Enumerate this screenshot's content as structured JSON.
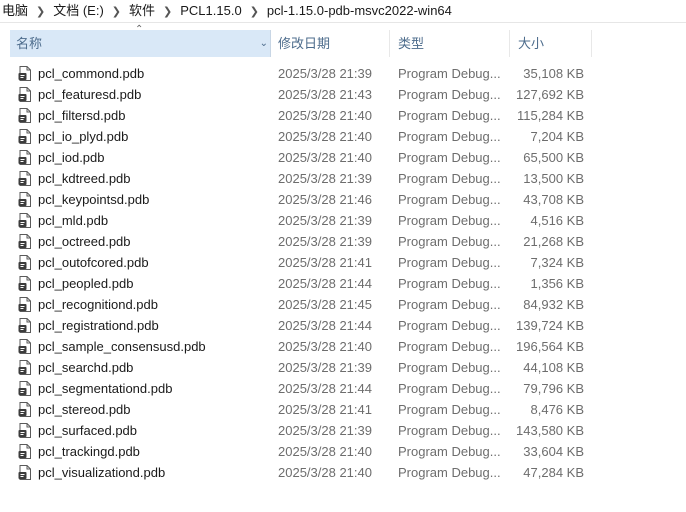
{
  "breadcrumb": [
    {
      "label": "电脑"
    },
    {
      "label": "文档 (E:)"
    },
    {
      "label": "软件"
    },
    {
      "label": "PCL1.15.0"
    },
    {
      "label": "pcl-1.15.0-pdb-msvc2022-win64"
    }
  ],
  "columns": {
    "name": "名称",
    "date": "修改日期",
    "type": "类型",
    "size": "大小"
  },
  "icons": {
    "file": "pdb-file-icon",
    "sort": "sort-up-icon",
    "dropdown": "chevron-down-icon"
  },
  "files": [
    {
      "name": "pcl_commond.pdb",
      "date": "2025/3/28 21:39",
      "type": "Program Debug...",
      "size": "35,108 KB"
    },
    {
      "name": "pcl_featuresd.pdb",
      "date": "2025/3/28 21:43",
      "type": "Program Debug...",
      "size": "127,692 KB"
    },
    {
      "name": "pcl_filtersd.pdb",
      "date": "2025/3/28 21:40",
      "type": "Program Debug...",
      "size": "115,284 KB"
    },
    {
      "name": "pcl_io_plyd.pdb",
      "date": "2025/3/28 21:40",
      "type": "Program Debug...",
      "size": "7,204 KB"
    },
    {
      "name": "pcl_iod.pdb",
      "date": "2025/3/28 21:40",
      "type": "Program Debug...",
      "size": "65,500 KB"
    },
    {
      "name": "pcl_kdtreed.pdb",
      "date": "2025/3/28 21:39",
      "type": "Program Debug...",
      "size": "13,500 KB"
    },
    {
      "name": "pcl_keypointsd.pdb",
      "date": "2025/3/28 21:46",
      "type": "Program Debug...",
      "size": "43,708 KB"
    },
    {
      "name": "pcl_mld.pdb",
      "date": "2025/3/28 21:39",
      "type": "Program Debug...",
      "size": "4,516 KB"
    },
    {
      "name": "pcl_octreed.pdb",
      "date": "2025/3/28 21:39",
      "type": "Program Debug...",
      "size": "21,268 KB"
    },
    {
      "name": "pcl_outofcored.pdb",
      "date": "2025/3/28 21:41",
      "type": "Program Debug...",
      "size": "7,324 KB"
    },
    {
      "name": "pcl_peopled.pdb",
      "date": "2025/3/28 21:44",
      "type": "Program Debug...",
      "size": "1,356 KB"
    },
    {
      "name": "pcl_recognitiond.pdb",
      "date": "2025/3/28 21:45",
      "type": "Program Debug...",
      "size": "84,932 KB"
    },
    {
      "name": "pcl_registrationd.pdb",
      "date": "2025/3/28 21:44",
      "type": "Program Debug...",
      "size": "139,724 KB"
    },
    {
      "name": "pcl_sample_consensusd.pdb",
      "date": "2025/3/28 21:40",
      "type": "Program Debug...",
      "size": "196,564 KB"
    },
    {
      "name": "pcl_searchd.pdb",
      "date": "2025/3/28 21:39",
      "type": "Program Debug...",
      "size": "44,108 KB"
    },
    {
      "name": "pcl_segmentationd.pdb",
      "date": "2025/3/28 21:44",
      "type": "Program Debug...",
      "size": "79,796 KB"
    },
    {
      "name": "pcl_stereod.pdb",
      "date": "2025/3/28 21:41",
      "type": "Program Debug...",
      "size": "8,476 KB"
    },
    {
      "name": "pcl_surfaced.pdb",
      "date": "2025/3/28 21:39",
      "type": "Program Debug...",
      "size": "143,580 KB"
    },
    {
      "name": "pcl_trackingd.pdb",
      "date": "2025/3/28 21:40",
      "type": "Program Debug...",
      "size": "33,604 KB"
    },
    {
      "name": "pcl_visualizationd.pdb",
      "date": "2025/3/28 21:40",
      "type": "Program Debug...",
      "size": "47,284 KB"
    }
  ]
}
